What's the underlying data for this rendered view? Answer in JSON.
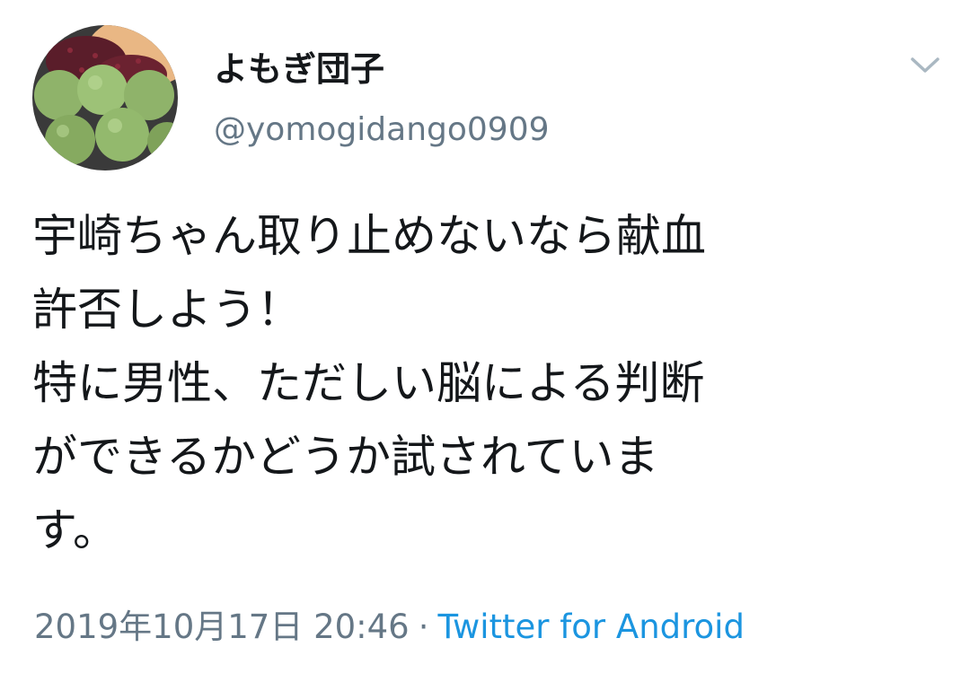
{
  "user": {
    "display_name": "よもぎ団子",
    "handle": "@yomogidango0909",
    "avatar_icon": "mochi-dango-avatar"
  },
  "menu": {
    "icon": "chevron-down-icon"
  },
  "tweet": {
    "text": "宇崎ちゃん取り止めないなら献血\n許否しよう！\n特に男性、ただしい脳による判断\nができるかどうか試されていま\nす。"
  },
  "meta": {
    "timestamp": "2019年10月17日 20:46",
    "separator": "·",
    "source": "Twitter for Android"
  },
  "colors": {
    "text": "#14171a",
    "secondary": "#657786",
    "link": "#1b95e0"
  }
}
